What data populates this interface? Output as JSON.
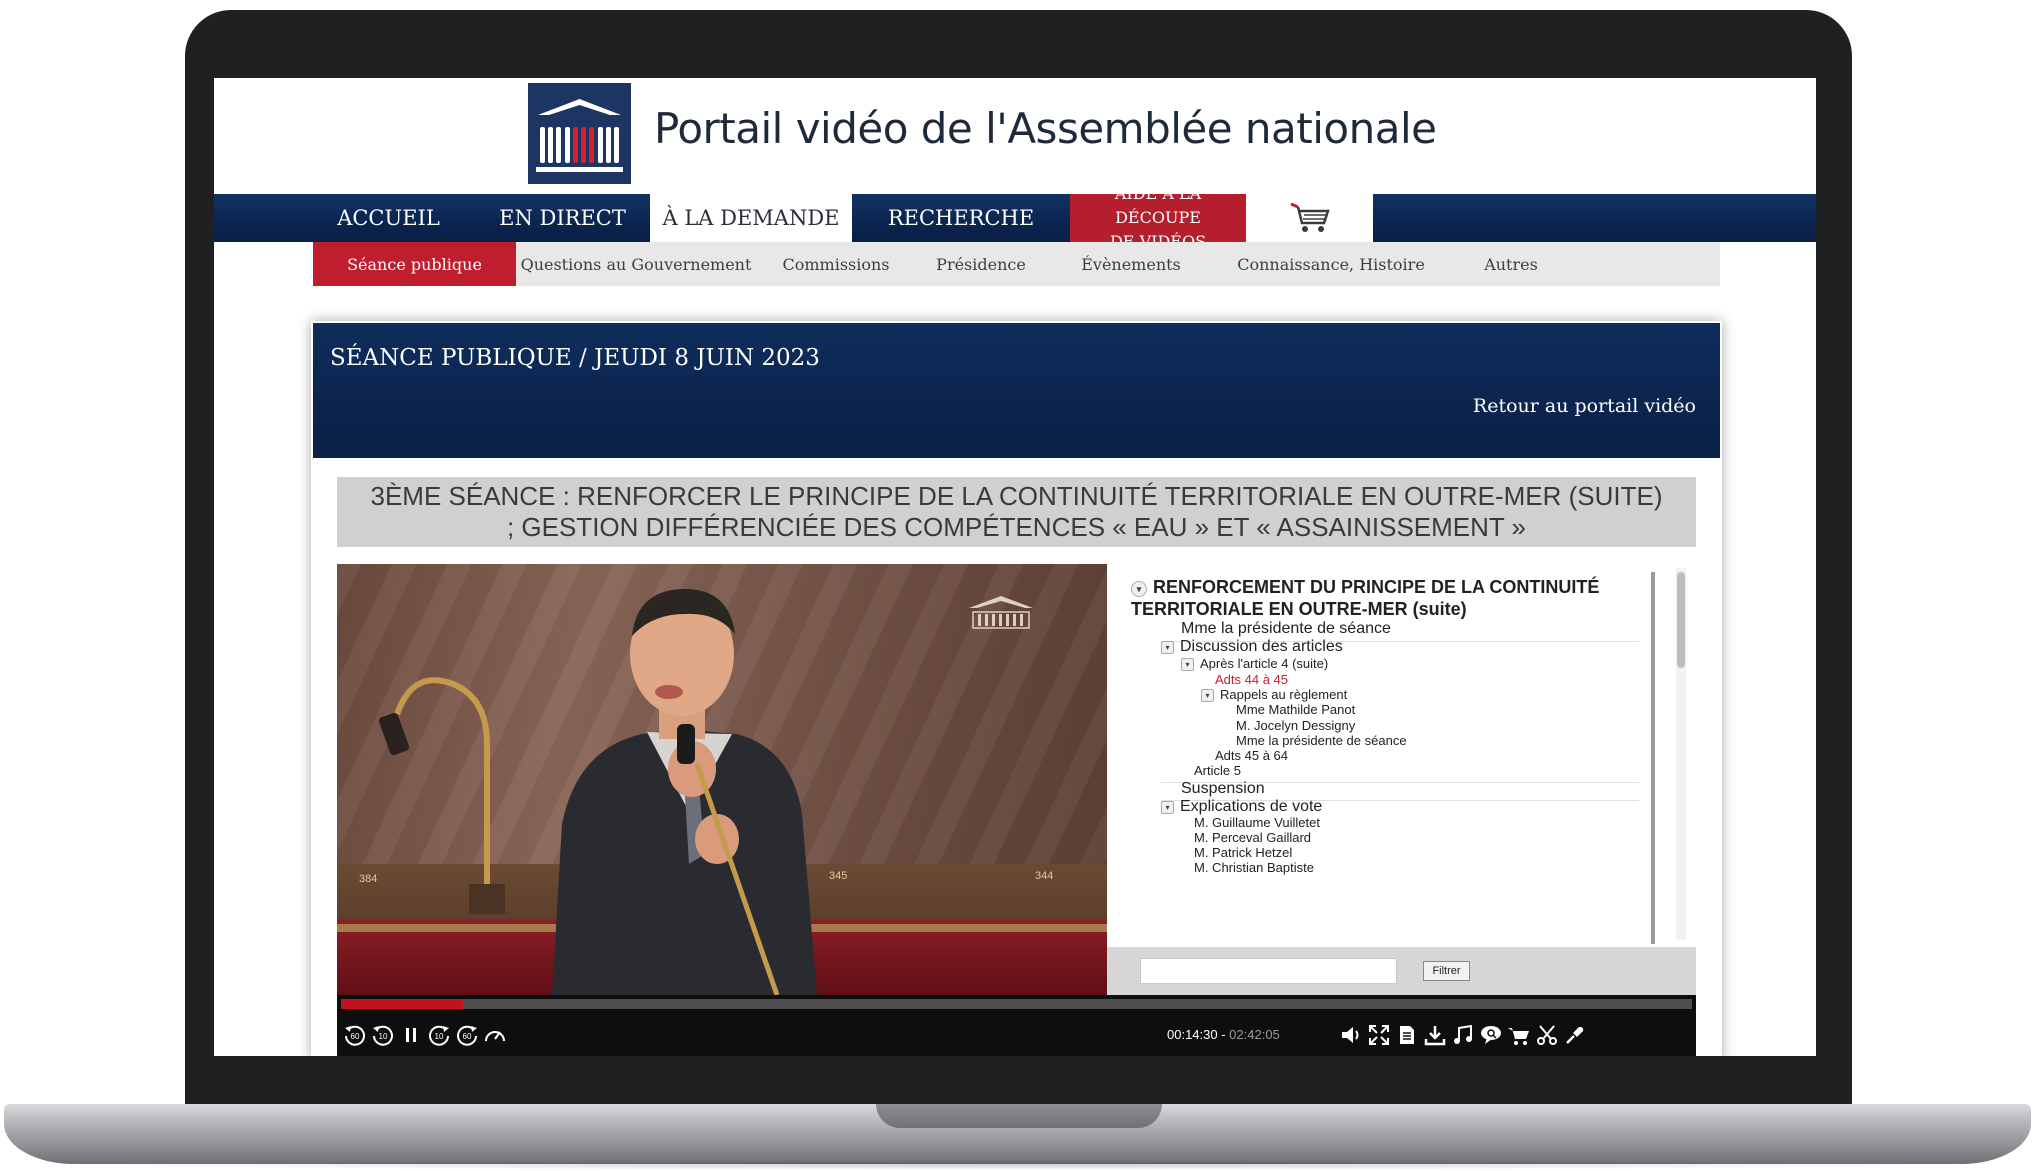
{
  "site": {
    "title": "Portail vidéo de l'Assemblée nationale"
  },
  "nav": {
    "items": [
      {
        "label": "ACCUEIL"
      },
      {
        "label": "EN DIRECT"
      },
      {
        "label": "À LA DEMANDE"
      },
      {
        "label": "RECHERCHE"
      },
      {
        "label_line1": "AIDE À LA DÉCOUPE",
        "label_line2": "DE VIDÉOS"
      }
    ],
    "active": "À LA DEMANDE",
    "cart_icon": "cart-icon"
  },
  "subnav": {
    "items": [
      "Séance publique",
      "Questions au Gouvernement",
      "Commissions",
      "Présidence",
      "Évènements",
      "Connaissance, Histoire",
      "Autres"
    ],
    "active": "Séance publique"
  },
  "session": {
    "title": "SÉANCE PUBLIQUE / JEUDI 8 JUIN 2023",
    "back_link": "Retour au portail vidéo"
  },
  "video": {
    "title_line1": "3ÈME SÉANCE : RENFORCER LE PRINCIPE DE LA CONTINUITÉ TERRITORIALE EN OUTRE-MER (SUITE)",
    "title_line2": "; GESTION DIFFÉRENCIÉE DES COMPÉTENCES « EAU » ET « ASSAINISSEMENT »",
    "seat_numbers": [
      "384",
      "345",
      "344"
    ]
  },
  "chapters": {
    "heading_line1": "RENFORCEMENT DU PRINCIPE DE LA CONTINUITÉ",
    "heading_line2": "TERRITORIALE EN OUTRE-MER (suite)",
    "items": [
      {
        "label": "Mme la présidente de séance"
      },
      {
        "label": "Discussion des articles"
      },
      {
        "label": "Après l'article 4 (suite)"
      },
      {
        "label": "Adts 44 à 45"
      },
      {
        "label": "Rappels au règlement"
      },
      {
        "label": "Mme Mathilde Panot"
      },
      {
        "label": "M. Jocelyn Dessigny"
      },
      {
        "label": "Mme la présidente de séance"
      },
      {
        "label": "Adts 45 à 64"
      },
      {
        "label": "Article 5"
      },
      {
        "label": "Suspension"
      },
      {
        "label": "Explications de vote"
      },
      {
        "label": "M. Guillaume Vuilletet"
      },
      {
        "label": "M. Perceval Gaillard"
      },
      {
        "label": "M. Patrick Hetzel"
      },
      {
        "label": "M. Christian Baptiste"
      }
    ],
    "active_item": "Adts 44 à 45",
    "filter_placeholder": "",
    "filter_button": "Filtrer",
    "accent_color": "#c4212f"
  },
  "player": {
    "current_time": "00:14:30",
    "separator": " - ",
    "duration": "02:42:05",
    "progress_fraction": 0.09,
    "rewind_labels": [
      "60",
      "10"
    ],
    "forward_labels": [
      "10",
      "60"
    ],
    "icons": [
      "rewind-60-icon",
      "rewind-10-icon",
      "pause-icon",
      "forward-10-icon",
      "forward-60-icon",
      "speed-icon",
      "volume-icon",
      "fullscreen-icon",
      "transcript-icon",
      "download-icon",
      "audio-icon",
      "subtitle-icon",
      "cart-icon",
      "scissors-icon",
      "share-icon"
    ]
  },
  "colors": {
    "navy": "#0b2550",
    "red": "#bf1e2e",
    "progress": "#c0131f"
  }
}
